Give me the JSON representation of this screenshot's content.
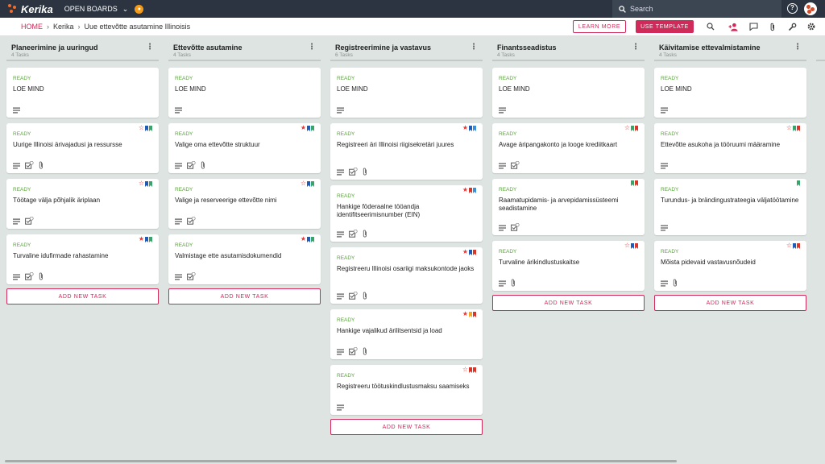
{
  "app": {
    "logo_text": "Kerika",
    "open_boards": "OPEN BOARDS",
    "search_placeholder": "Search"
  },
  "breadcrumb": {
    "home": "HOME",
    "org": "Kerika",
    "board": "Uue ettevõtte asutamine Illinoisis"
  },
  "toolbar": {
    "learn_more": "LEARN MORE",
    "use_template": "USE TEMPLATE"
  },
  "colors": {
    "accent": "#d02a5a",
    "ready": "#58a33a",
    "topbar": "#2b3440",
    "board_bg": "#dde4e1",
    "flag_blue": "#1f5bb5",
    "flag_green": "#3aa36a",
    "flag_red": "#d8362a",
    "flag_orange": "#f5a623",
    "flag_sky": "#3b8fd9"
  },
  "add_task_label": "ADD NEW TASK",
  "columns": [
    {
      "title": "Planeerimine ja uuringud",
      "count": "4 Tasks",
      "cards": [
        {
          "status": "READY",
          "name": "LOE MIND",
          "icons": [
            "lines"
          ],
          "flags": []
        },
        {
          "status": "READY",
          "name": "Uurige Illinoisi ärivajadusi ja ressursse",
          "icons": [
            "lines",
            "check",
            "clip"
          ],
          "flags": [
            "star-outline",
            "blue",
            "green"
          ]
        },
        {
          "status": "READY",
          "name": "Töötage välja põhjalik äriplaan",
          "icons": [
            "lines",
            "check"
          ],
          "flags": [
            "star-outline",
            "blue",
            "green"
          ]
        },
        {
          "status": "READY",
          "name": "Turvaline idufirmade rahastamine",
          "icons": [
            "lines",
            "check",
            "clip"
          ],
          "flags": [
            "star",
            "blue",
            "green"
          ]
        }
      ]
    },
    {
      "title": "Ettevõtte asutamine",
      "count": "4 Tasks",
      "cards": [
        {
          "status": "READY",
          "name": "LOE MIND",
          "icons": [
            "lines"
          ],
          "flags": []
        },
        {
          "status": "READY",
          "name": "Valige oma ettevõtte struktuur",
          "icons": [
            "lines",
            "check",
            "clip"
          ],
          "flags": [
            "star",
            "blue",
            "green"
          ]
        },
        {
          "status": "READY",
          "name": "Valige ja reserveerige ettevõtte nimi",
          "icons": [
            "lines",
            "check"
          ],
          "flags": [
            "star-outline",
            "blue",
            "green"
          ]
        },
        {
          "status": "READY",
          "name": "Valmistage ette asutamisdokumendid",
          "icons": [
            "lines",
            "check"
          ],
          "flags": [
            "star",
            "blue",
            "green"
          ]
        }
      ]
    },
    {
      "title": "Registreerimine ja vastavus",
      "count": "6 Tasks",
      "cards": [
        {
          "status": "READY",
          "name": "LOE MIND",
          "icons": [
            "lines"
          ],
          "flags": []
        },
        {
          "status": "READY",
          "name": "Registreeri äri Illinoisi riigisekretäri juures",
          "icons": [
            "lines",
            "check",
            "clip"
          ],
          "flags": [
            "star",
            "blue",
            "sky"
          ]
        },
        {
          "status": "READY",
          "name": "Hankige föderaalne tööandja identifitseerimisnumber (EIN)",
          "icons": [
            "lines",
            "check",
            "clip"
          ],
          "flags": [
            "star",
            "red",
            "sky"
          ]
        },
        {
          "status": "READY",
          "name": "Registreeru Illinoisi osariigi maksukontode jaoks",
          "icons": [
            "lines",
            "check",
            "clip"
          ],
          "flags": [
            "star",
            "blue",
            "red"
          ]
        },
        {
          "status": "READY",
          "name": "Hankige vajalikud ärilitsentsid ja load",
          "icons": [
            "lines",
            "check",
            "clip"
          ],
          "flags": [
            "star",
            "orange",
            "red"
          ]
        },
        {
          "status": "READY",
          "name": "Registreeru töötuskindlustusmaksu saamiseks",
          "icons": [
            "lines"
          ],
          "flags": [
            "star-outline",
            "red",
            "red"
          ]
        }
      ]
    },
    {
      "title": "Finantsseadistus",
      "count": "4 Tasks",
      "cards": [
        {
          "status": "READY",
          "name": "LOE MIND",
          "icons": [
            "lines"
          ],
          "flags": []
        },
        {
          "status": "READY",
          "name": "Avage äripangakonto ja looge krediitkaart",
          "icons": [
            "lines",
            "check"
          ],
          "flags": [
            "star-outline",
            "green",
            "red"
          ]
        },
        {
          "status": "READY",
          "name": "Raamatupidamis- ja arvepidamissüsteemi seadistamine",
          "icons": [
            "lines",
            "check"
          ],
          "flags": [
            "green",
            "red"
          ]
        },
        {
          "status": "READY",
          "name": "Turvaline ärikindlustuskaitse",
          "icons": [
            "lines",
            "clip"
          ],
          "flags": [
            "star-outline",
            "blue",
            "red"
          ]
        }
      ]
    },
    {
      "title": "Käivitamise ettevalmistamine",
      "count": "4 Tasks",
      "cards": [
        {
          "status": "READY",
          "name": "LOE MIND",
          "icons": [
            "lines"
          ],
          "flags": []
        },
        {
          "status": "READY",
          "name": "Ettevõtte asukoha ja tööruumi määramine",
          "icons": [
            "lines"
          ],
          "flags": [
            "star-outline",
            "green",
            "red"
          ]
        },
        {
          "status": "READY",
          "name": "Turundus- ja brändingustrateegia väljatöötamine",
          "icons": [
            "lines"
          ],
          "flags": [
            "green"
          ]
        },
        {
          "status": "READY",
          "name": "Mõista pidevaid vastavusnõudeid",
          "icons": [
            "lines",
            "clip"
          ],
          "flags": [
            "star-outline",
            "blue",
            "red"
          ]
        }
      ]
    }
  ]
}
